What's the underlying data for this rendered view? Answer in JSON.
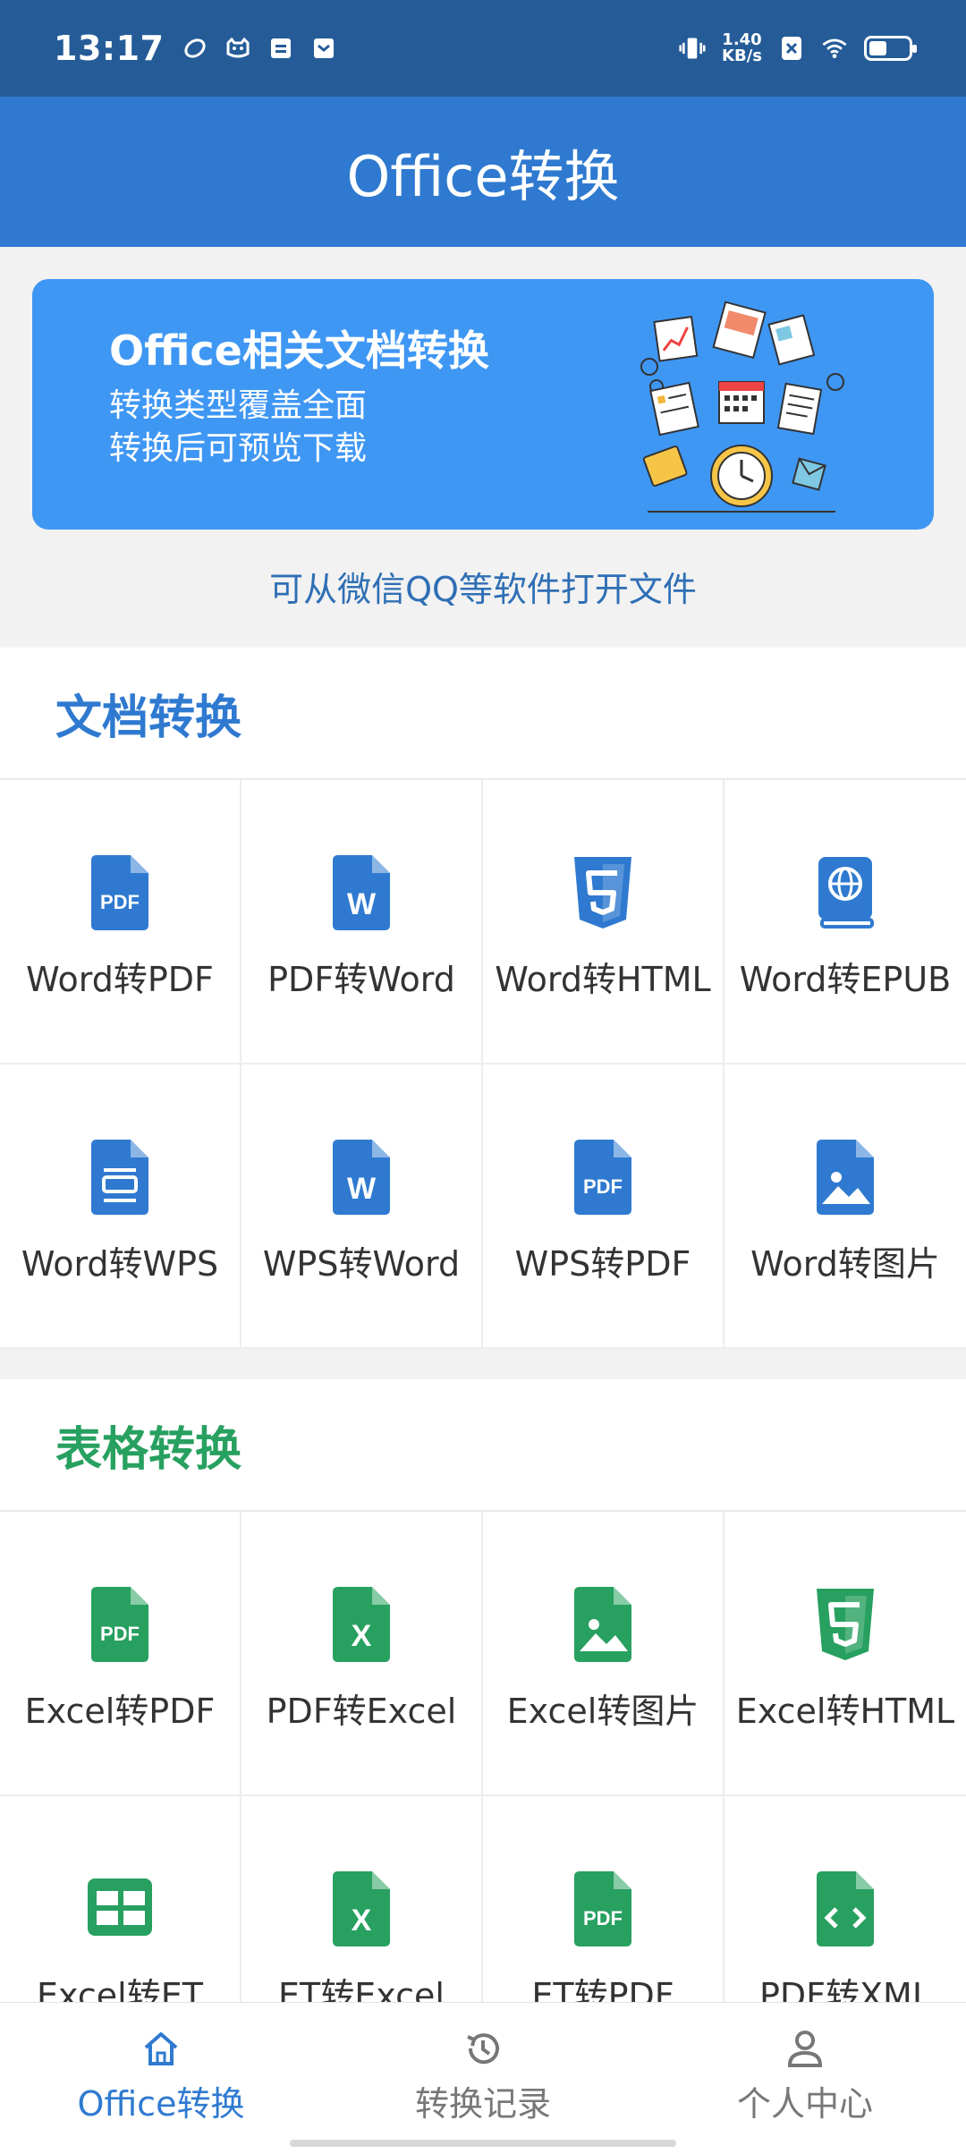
{
  "status_bar": {
    "time": "13:17",
    "net_speed_value": "1.40",
    "net_speed_unit": "KB/s",
    "battery_level": 0.45
  },
  "app_bar": {
    "title": "Office转换"
  },
  "banner": {
    "title": "Office相关文档转换",
    "line1": "转换类型覆盖全面",
    "line2": "转换后可预览下载",
    "hint": "可从微信QQ等软件打开文件"
  },
  "doc_section": {
    "title": "文档转换",
    "color": "#2f7ad0",
    "items": [
      {
        "label": "Word转PDF",
        "icon": "pdf-file-icon"
      },
      {
        "label": "PDF转Word",
        "icon": "word-file-icon"
      },
      {
        "label": "Word转HTML",
        "icon": "html5-icon"
      },
      {
        "label": "Word转EPUB",
        "icon": "ebook-icon"
      },
      {
        "label": "Word转WPS",
        "icon": "wps-file-icon"
      },
      {
        "label": "WPS转Word",
        "icon": "word-file-icon"
      },
      {
        "label": "WPS转PDF",
        "icon": "pdf-file-icon"
      },
      {
        "label": "Word转图片",
        "icon": "image-file-icon"
      }
    ]
  },
  "sheet_section": {
    "title": "表格转换",
    "color": "#27a060",
    "items": [
      {
        "label": "Excel转PDF",
        "icon": "pdf-file-icon"
      },
      {
        "label": "PDF转Excel",
        "icon": "excel-file-icon"
      },
      {
        "label": "Excel转图片",
        "icon": "image-file-icon"
      },
      {
        "label": "Excel转HTML",
        "icon": "html5-icon"
      },
      {
        "label": "Excel转ET",
        "icon": "table-grid-icon"
      },
      {
        "label": "ET转Excel",
        "icon": "excel-file-icon"
      },
      {
        "label": "ET转PDF",
        "icon": "pdf-file-icon"
      },
      {
        "label": "PDF转XML",
        "icon": "code-file-icon"
      }
    ]
  },
  "bottom_nav": {
    "active_color": "#2f7ad0",
    "items": [
      {
        "label": "Office转换",
        "icon": "home-icon",
        "active": true
      },
      {
        "label": "转换记录",
        "icon": "history-icon",
        "active": false
      },
      {
        "label": "个人中心",
        "icon": "person-icon",
        "active": false
      }
    ]
  }
}
